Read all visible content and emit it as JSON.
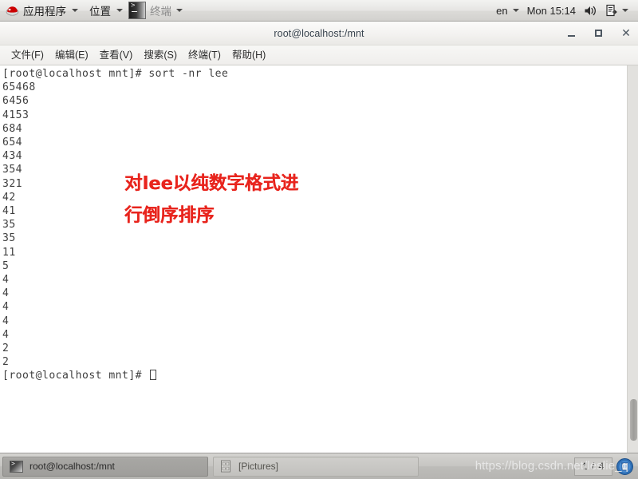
{
  "top_panel": {
    "logo_icon": "redhat-logo-icon",
    "applications_label": "应用程序",
    "places_label": "位置",
    "terminal_label": "终端",
    "keyboard_layout": "en",
    "clock": "Mon 15:14",
    "volume_icon": "speaker-icon",
    "notification_icon": "document-update-icon",
    "dropdown_icon": "chevron-down-icon"
  },
  "window": {
    "title": "root@localhost:/mnt",
    "minimize_label": "_",
    "maximize_label": "□",
    "close_label": "✕",
    "menus": [
      {
        "label": "文件(F)"
      },
      {
        "label": "编辑(E)"
      },
      {
        "label": "查看(V)"
      },
      {
        "label": "搜索(S)"
      },
      {
        "label": "终端(T)"
      },
      {
        "label": "帮助(H)"
      }
    ]
  },
  "terminal": {
    "prompt": "[root@localhost mnt]# ",
    "command": "sort -nr lee",
    "output_lines": [
      "65468",
      "6456",
      "4153",
      "684",
      "654",
      "434",
      "354",
      "321",
      "42",
      "41",
      "35",
      "35",
      "11",
      "5",
      "4",
      "4",
      "4",
      "4",
      "4",
      "2",
      "2"
    ],
    "final_prompt": "[root@localhost mnt]# ",
    "text_block": "[root@localhost mnt]# sort -nr lee\n65468\n6456\n4153\n684\n654\n434\n354\n321\n42\n41\n35\n35\n11\n5\n4\n4\n4\n4\n4\n2\n2\n[root@localhost mnt]# ",
    "annotation": "对lee以纯数字格式进\n行倒序排序",
    "annotation_color": "#e8241d"
  },
  "taskbar": {
    "items": [
      {
        "label": "root@localhost:/mnt",
        "icon": "terminal-icon",
        "active": true
      },
      {
        "label": "[Pictures]",
        "icon": "file-manager-icon",
        "active": false
      }
    ],
    "workspace_indicator": "1 / 4",
    "trash_icon": "trash-icon"
  },
  "watermark": {
    "text": "https://blog.csdn.net/leslie_q"
  }
}
